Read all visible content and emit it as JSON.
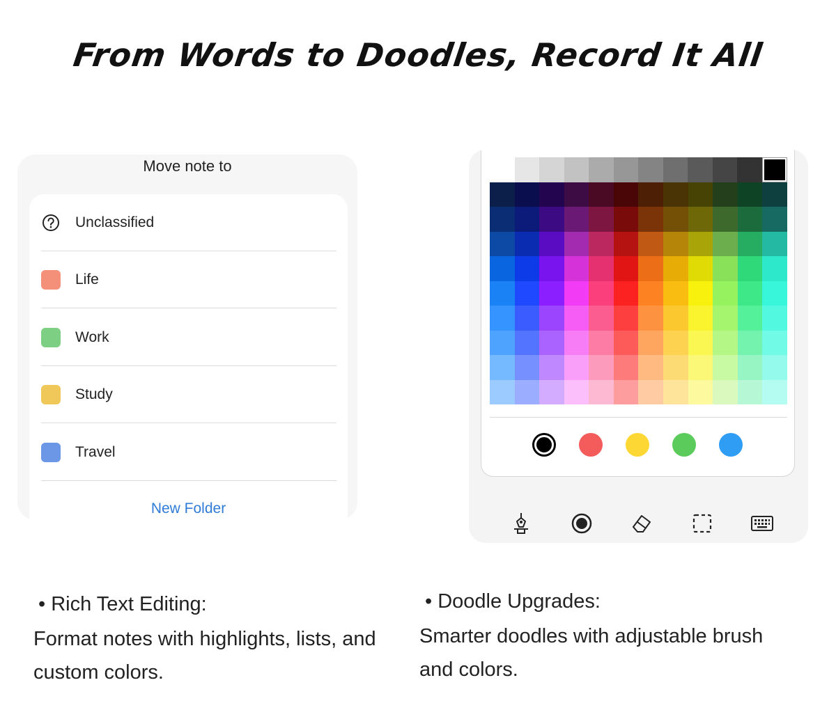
{
  "headline": "From Words to Doodles, Record It All",
  "move_note": {
    "title": "Move note to",
    "folders": [
      {
        "label": "Unclassified",
        "icon": "question-circle-icon",
        "color": null
      },
      {
        "label": "Life",
        "icon": "folder-color-swatch",
        "color": "#f4907a"
      },
      {
        "label": "Work",
        "icon": "folder-color-swatch",
        "color": "#7dd083"
      },
      {
        "label": "Study",
        "icon": "folder-color-swatch",
        "color": "#f0c85a"
      },
      {
        "label": "Travel",
        "icon": "folder-color-swatch",
        "color": "#6b97e6"
      }
    ],
    "new_folder_label": "New Folder"
  },
  "doodle": {
    "gray_row": [
      "#ffffff",
      "#e6e6e6",
      "#d5d5d5",
      "#c2c2c2",
      "#ababab",
      "#979797",
      "#848484",
      "#6f6f6f",
      "#5a5a5a",
      "#454545",
      "#333333",
      "#000000"
    ],
    "selected_color": "#000000",
    "palette_columns": [
      [
        "#0b1f4a",
        "#0a2d73",
        "#0d4aa6",
        "#0a66e0",
        "#1a82f5",
        "#3594ff",
        "#4ea3ff",
        "#75b9ff",
        "#9ccbff"
      ],
      [
        "#0a0e4e",
        "#0c1a7a",
        "#0a2cb0",
        "#0e3be8",
        "#1f49ff",
        "#3b5dff",
        "#5374ff",
        "#7690ff",
        "#9aadff"
      ],
      [
        "#23054f",
        "#3c0a82",
        "#5a0cc2",
        "#7a14ee",
        "#8b1fff",
        "#9b45ff",
        "#aa63ff",
        "#bf88ff",
        "#d4acff"
      ],
      [
        "#3d0c44",
        "#6a1a74",
        "#a22bb0",
        "#d632d9",
        "#f13bf4",
        "#f55df5",
        "#f77df7",
        "#f99ff9",
        "#fbbffb"
      ],
      [
        "#4a0a24",
        "#7d1741",
        "#bb2860",
        "#e5316f",
        "#fa3f7c",
        "#fc5d90",
        "#fd7ca6",
        "#fd9bbd",
        "#feb9d2"
      ],
      [
        "#4a0606",
        "#790b0b",
        "#b51212",
        "#e21515",
        "#fd2222",
        "#fd3f3f",
        "#fd5a5a",
        "#fd7b7b",
        "#fe9d9d"
      ],
      [
        "#4d1f05",
        "#7a3407",
        "#bf5913",
        "#ec6f17",
        "#fd8322",
        "#fd9340",
        "#fea65f",
        "#feba80",
        "#fecba2"
      ],
      [
        "#4a3304",
        "#744f06",
        "#b5850a",
        "#e7ac06",
        "#f9bd12",
        "#fbc830",
        "#fcd250",
        "#fcdb74",
        "#fde49a"
      ],
      [
        "#474305",
        "#6e6808",
        "#a9a408",
        "#e1db05",
        "#f7f10d",
        "#f9f42e",
        "#faf652",
        "#fbf878",
        "#fcf99e"
      ],
      [
        "#233f1c",
        "#3d6a2c",
        "#6cae4d",
        "#88e158",
        "#96f25e",
        "#a5f56f",
        "#b5f787",
        "#c8f9a3",
        "#daf9bf"
      ],
      [
        "#0f4325",
        "#1b6b3d",
        "#27ad61",
        "#2fd97a",
        "#3ee888",
        "#55f09a",
        "#74f3ae",
        "#96f5c3",
        "#b6f8d6"
      ],
      [
        "#0e4040",
        "#166a62",
        "#24b9a3",
        "#2ee8cb",
        "#38f6d9",
        "#52f8e0",
        "#71fae6",
        "#94fbec",
        "#b4fcf1"
      ]
    ],
    "recent_colors": [
      {
        "name": "black",
        "color": "#000000"
      },
      {
        "name": "red",
        "color": "#f45b5b"
      },
      {
        "name": "yellow",
        "color": "#fdd835"
      },
      {
        "name": "green",
        "color": "#5bcc5b"
      },
      {
        "name": "blue",
        "color": "#2f9df4"
      }
    ],
    "tools": [
      "pen-nib-icon",
      "brush-size-icon",
      "eraser-icon",
      "lasso-select-icon",
      "keyboard-icon"
    ]
  },
  "features": {
    "rich_text": {
      "title": "• Rich Text Editing:",
      "desc_line1": "Format notes with highlights, lists, and",
      "desc_line2": "custom colors."
    },
    "doodle": {
      "title": "• Doodle Upgrades:",
      "desc_line1": "Smarter doodles with adjustable brush",
      "desc_line2": "and colors."
    }
  }
}
